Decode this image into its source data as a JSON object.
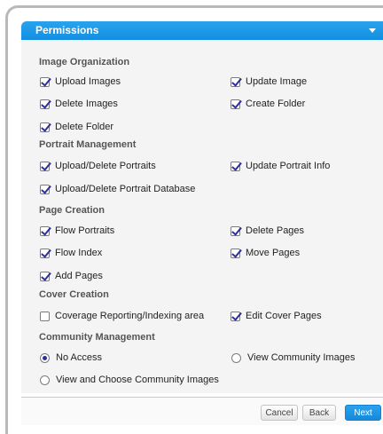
{
  "header": {
    "title": "Permissions",
    "icon": "chevron-down-icon",
    "color": "#1a96e6"
  },
  "sections": {
    "image_organization": {
      "title": "Image Organization",
      "upload_images": {
        "label": "Upload Images",
        "checked": true
      },
      "update_image": {
        "label": "Update Image",
        "checked": true
      },
      "delete_images": {
        "label": "Delete Images",
        "checked": true
      },
      "create_folder": {
        "label": "Create Folder",
        "checked": true
      },
      "delete_folder": {
        "label": "Delete Folder",
        "checked": true
      }
    },
    "portrait_management": {
      "title": "Portrait Management",
      "upload_delete_portraits": {
        "label": "Upload/Delete Portraits",
        "checked": true
      },
      "update_portrait_info": {
        "label": "Update Portrait Info",
        "checked": true
      },
      "upload_delete_portrait_database": {
        "label": "Upload/Delete Portrait Database",
        "checked": true
      }
    },
    "page_creation": {
      "title": "Page Creation",
      "flow_portraits": {
        "label": "Flow Portraits",
        "checked": true
      },
      "delete_pages": {
        "label": "Delete Pages",
        "checked": true
      },
      "flow_index": {
        "label": "Flow Index",
        "checked": true
      },
      "move_pages": {
        "label": "Move Pages",
        "checked": true
      },
      "add_pages": {
        "label": "Add Pages",
        "checked": true
      }
    },
    "cover_creation": {
      "title": "Cover Creation",
      "coverage_reporting": {
        "label": "Coverage Reporting/Indexing area",
        "checked": false
      },
      "edit_cover_pages": {
        "label": "Edit Cover Pages",
        "checked": true
      }
    },
    "community_management": {
      "title": "Community Management",
      "selected": "No Access",
      "no_access": {
        "label": "No Access",
        "checked": true
      },
      "view_community_images": {
        "label": "View Community Images",
        "checked": false
      },
      "view_and_choose": {
        "label": "View and Choose Community Images",
        "checked": false
      }
    }
  },
  "footer": {
    "cancel_label": "Cancel",
    "back_label": "Back",
    "next_label": "Next"
  }
}
